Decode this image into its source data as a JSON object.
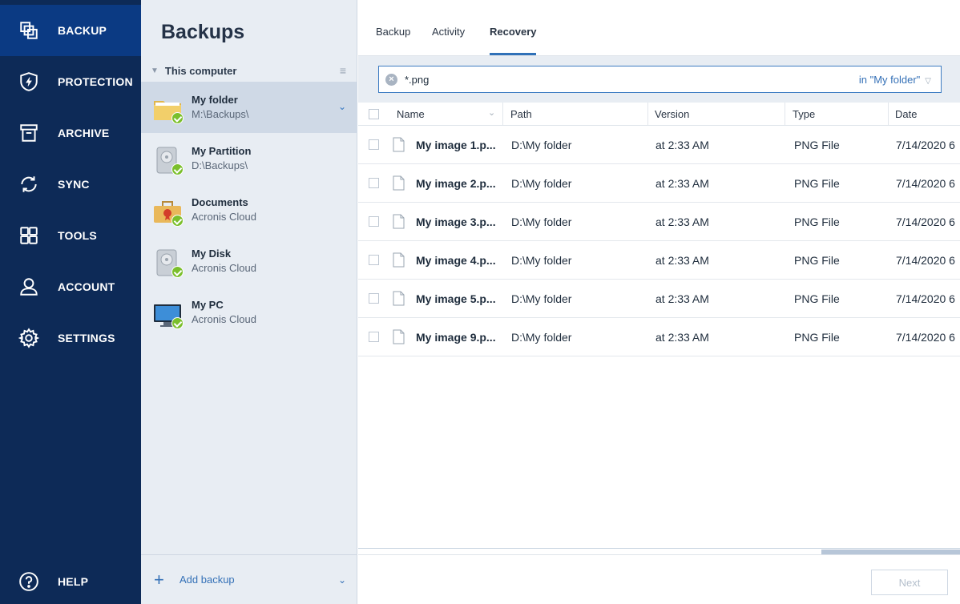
{
  "nav": {
    "items": [
      {
        "label": "BACKUP",
        "icon": "backup-icon",
        "active": true
      },
      {
        "label": "PROTECTION",
        "icon": "shield-icon"
      },
      {
        "label": "ARCHIVE",
        "icon": "archive-icon"
      },
      {
        "label": "SYNC",
        "icon": "sync-icon"
      },
      {
        "label": "TOOLS",
        "icon": "tools-icon"
      },
      {
        "label": "ACCOUNT",
        "icon": "account-icon"
      },
      {
        "label": "SETTINGS",
        "icon": "gear-icon"
      }
    ],
    "help": {
      "label": "HELP",
      "icon": "help-icon"
    }
  },
  "backups": {
    "title": "Backups",
    "group": "This computer",
    "items": [
      {
        "name": "My folder",
        "location": "M:\\Backups\\",
        "icon": "folder-icon"
      },
      {
        "name": "My Partition",
        "location": "D:\\Backups\\",
        "icon": "disk-icon"
      },
      {
        "name": "Documents",
        "location": "Acronis Cloud",
        "icon": "briefcase-icon"
      },
      {
        "name": "My Disk",
        "location": "Acronis Cloud",
        "icon": "disk-icon"
      },
      {
        "name": "My PC",
        "location": "Acronis Cloud",
        "icon": "monitor-icon"
      }
    ],
    "add_label": "Add backup"
  },
  "tabs": [
    "Backup",
    "Activity",
    "Recovery"
  ],
  "search": {
    "value": "*.png",
    "scope": "in \"My folder\""
  },
  "table": {
    "columns": [
      "Name",
      "Path",
      "Version",
      "Type",
      "Date"
    ],
    "rows": [
      {
        "name": "My image 1.p...",
        "path": "D:\\My folder",
        "version": "at 2:33 AM",
        "type": "PNG File",
        "date": "7/14/2020 6"
      },
      {
        "name": "My image 2.p...",
        "path": "D:\\My folder",
        "version": "at 2:33 AM",
        "type": "PNG File",
        "date": "7/14/2020 6"
      },
      {
        "name": "My image 3.p...",
        "path": "D:\\My folder",
        "version": "at 2:33 AM",
        "type": "PNG File",
        "date": "7/14/2020 6"
      },
      {
        "name": "My image 4.p...",
        "path": "D:\\My folder",
        "version": "at 2:33 AM",
        "type": "PNG File",
        "date": "7/14/2020 6"
      },
      {
        "name": "My image 5.p...",
        "path": "D:\\My folder",
        "version": "at 2:33 AM",
        "type": "PNG File",
        "date": "7/14/2020 6"
      },
      {
        "name": "My image 9.p...",
        "path": "D:\\My folder",
        "version": "at 2:33 AM",
        "type": "PNG File",
        "date": "7/14/2020 6"
      }
    ]
  },
  "footer": {
    "next_label": "Next"
  },
  "colors": {
    "nav_bg": "#0d2a57",
    "nav_active": "#0b3a83",
    "accent": "#3071b8",
    "ok_green": "#7bbf2c"
  }
}
